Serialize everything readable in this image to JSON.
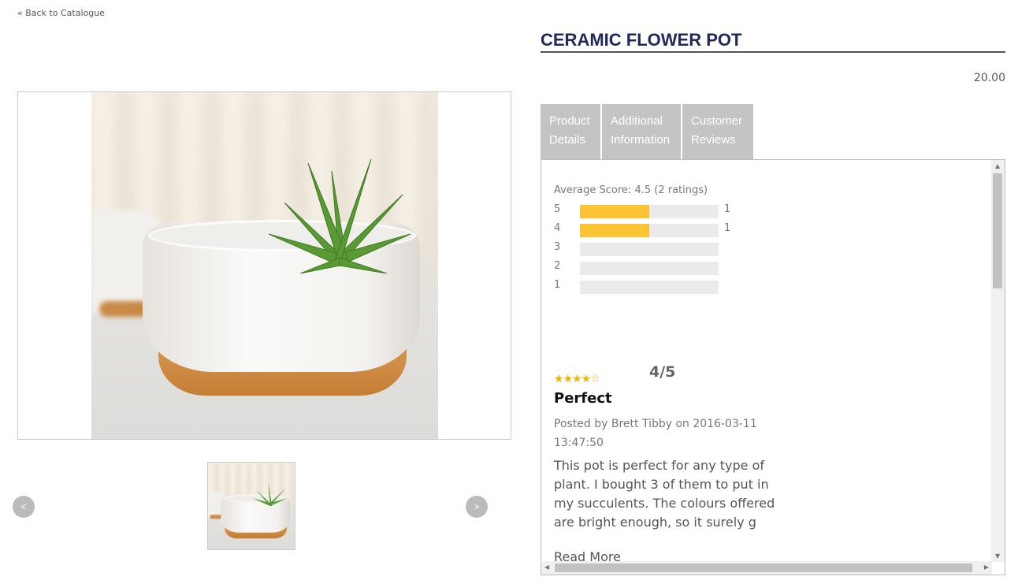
{
  "nav": {
    "back_label": "« Back to Catalogue",
    "prev_label": "<",
    "next_label": ">"
  },
  "product": {
    "title": "CERAMIC FLOWER POT",
    "price": "20.00"
  },
  "tabs": [
    {
      "label": "Product Details"
    },
    {
      "label": "Additional Information"
    },
    {
      "label": "Customer Reviews"
    }
  ],
  "active_tab": "Customer Reviews",
  "reviews": {
    "average": "Average Score: 4.5 (2 ratings)",
    "breakdown": [
      {
        "stars": "5",
        "count": "1",
        "fraction": 0.5
      },
      {
        "stars": "4",
        "count": "1",
        "fraction": 0.5
      },
      {
        "stars": "3",
        "count": "",
        "fraction": 0
      },
      {
        "stars": "2",
        "count": "",
        "fraction": 0
      },
      {
        "stars": "1",
        "count": "",
        "fraction": 0
      }
    ],
    "items": [
      {
        "rating": 4,
        "stars": "★★★★☆",
        "score": "4/5",
        "title": "Perfect",
        "posted": "Posted by Brett Tibby on 2016-03-11 13:47:50",
        "body": "This pot is perfect for any type of plant. I bought 3 of them to put in my succulents. The colours offered are bright enough, so it surely g",
        "read_more": "Read More"
      }
    ]
  },
  "colors": {
    "accent": "#fcc432",
    "title": "#22295a",
    "tab": "#c4c4c4",
    "star": "#f0b400"
  }
}
